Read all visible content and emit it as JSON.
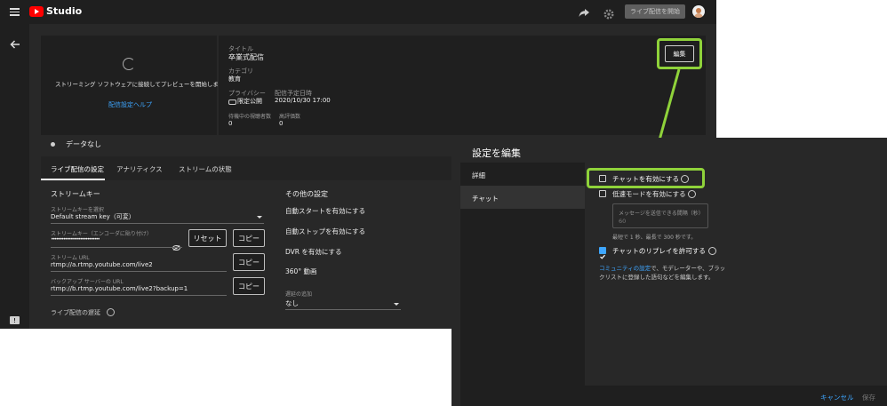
{
  "topbar": {
    "app_name": "Studio",
    "start_live_button": "ライブ配信を開始"
  },
  "preview": {
    "message": "ストリーミング ソフトウェアに接続してプレビューを開始します",
    "help_link": "配信設定ヘルプ"
  },
  "details": {
    "title_label": "タイトル",
    "title_value": "卒業式配信",
    "category_label": "カテゴリ",
    "category_value": "教育",
    "privacy_label": "プライバシー",
    "privacy_value": "限定公開",
    "schedule_label": "配信予定日時",
    "schedule_value": "2020/10/30 17:00",
    "waiting_label": "待機中の視聴者数",
    "waiting_value": "0",
    "likes_label": "高評価数",
    "likes_value": "0",
    "edit_button": "編集"
  },
  "status": {
    "no_data": "データなし"
  },
  "tabs": [
    "ライブ配信の設定",
    "アナリティクス",
    "ストリームの状態"
  ],
  "stream": {
    "section_title": "ストリームキー",
    "key_select_label": "ストリームキーを選択",
    "key_select_value": "Default stream key（可変）",
    "key_field_label": "ストリームキー（エンコーダに貼り付け）",
    "key_field_value": "••••••••••••••••••••••••••••",
    "reset_button": "リセット",
    "copy_button": "コピー",
    "url_label": "ストリーム URL",
    "url_value": "rtmp://a.rtmp.youtube.com/live2",
    "backup_label": "バックアップ サーバーの URL",
    "backup_value": "rtmp://b.rtmp.youtube.com/live2?backup=1",
    "latency_label": "ライブ配信の遅延"
  },
  "other": {
    "section_title": "その他の設定",
    "items": [
      "自動スタートを有効にする",
      "自動ストップを有効にする",
      "DVR を有効にする",
      "360° 動画"
    ],
    "delay_label": "遅延の追加",
    "delay_value": "なし"
  },
  "dialog": {
    "title": "設定を編集",
    "nav": [
      "詳細",
      "チャット"
    ],
    "enable_chat": "チャットを有効にする",
    "slow_mode": "低速モードを有効にする",
    "interval_label": "メッセージを送信できる間隔（秒）",
    "interval_placeholder": "60",
    "interval_hint": "最短で 1 秒、最長で 300 秒です。",
    "replay": "チャットのリプレイを許可する",
    "community_link": "コミュニティの設定",
    "community_text1": "で、モデレーターや、ブラッ",
    "community_text2": "クリストに登録した語句などを編集します。",
    "cancel": "キャンセル",
    "save": "保存"
  },
  "colors": {
    "background": "#282828",
    "panel": "#1f1f1f",
    "highlight": "#8fd23a",
    "accent_blue": "#3ea6ff",
    "logo_red": "#ff0000"
  }
}
